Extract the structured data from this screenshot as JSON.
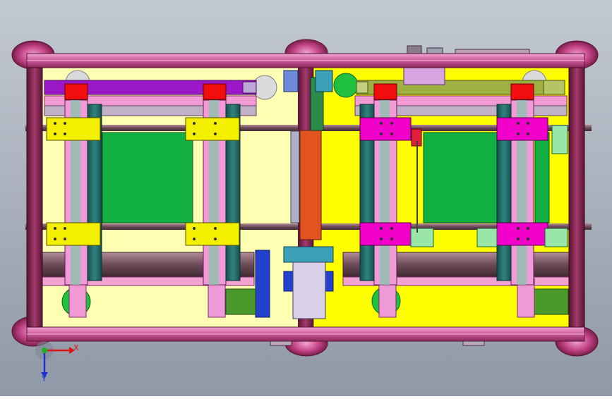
{
  "viewport": {
    "background_top": "#c3c9d2",
    "background_bottom": "#8f98a6"
  },
  "colors": {
    "frame": "#b13a77",
    "frame_dark": "#6f1c43",
    "frame_light": "#e07ab2",
    "plate_left": "#ffffb4",
    "plate_right": "#ffff00",
    "rail_purple": "#9b18c9",
    "rail_olive": "#9fb043",
    "column_teal": "#256e6a",
    "column_pink": "#f09ad8",
    "block_yellow": "#f4f000",
    "block_magenta": "#f000c8",
    "cap_red": "#f20e0e",
    "pcb_green": "#12b043",
    "motor_green": "#4a9a2b",
    "blue_part": "#2340ce",
    "orange_part": "#e2541f",
    "gray_beam": "#8a6270"
  },
  "triad": {
    "x_label": "X",
    "y_label": "Y",
    "x_color": "#e01010",
    "y_color": "#2030d0",
    "origin_color": "#20b020"
  }
}
